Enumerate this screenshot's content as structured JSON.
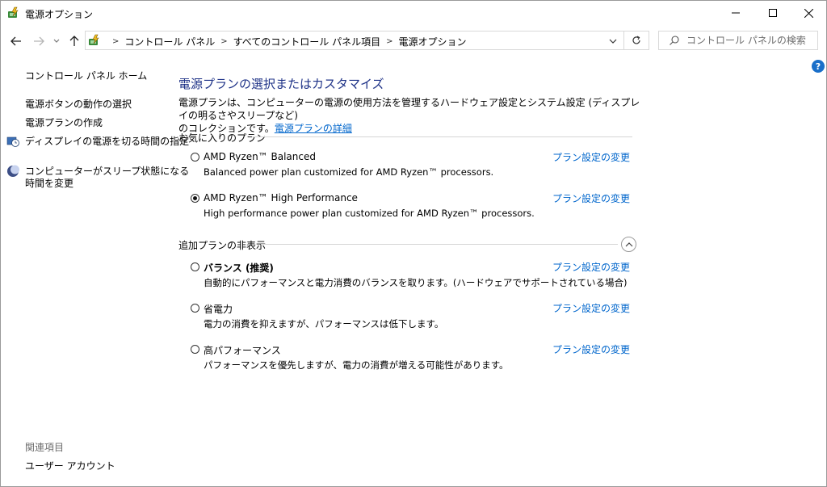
{
  "window": {
    "title": "電源オプション",
    "controls": {
      "minimize": "—",
      "maximize": "☐",
      "close": "✕"
    }
  },
  "address_bar": {
    "breadcrumbs": [
      "コントロール パネル",
      "すべてのコントロール パネル項目",
      "電源オプション"
    ]
  },
  "search": {
    "placeholder": "コントロール パネルの検索"
  },
  "sidebar": {
    "home": "コントロール パネル ホーム",
    "items": [
      "電源ボタンの動作の選択",
      "電源プランの作成",
      "ディスプレイの電源を切る時間の指定",
      "コンピューターがスリープ状態になる",
      "時間を変更"
    ],
    "related_header": "関連項目",
    "related_items": [
      "ユーザー アカウント"
    ]
  },
  "main": {
    "heading": "電源プランの選択またはカスタマイズ",
    "description_line1": "電源プランは、コンピューターの電源の使用方法を管理するハードウェア設定とシステム設定 (ディスプレイの明るさやスリープなど)",
    "description_line2": "のコレクションです。",
    "description_link": "電源プランの詳細",
    "favorites_header": "お気に入りのプラン",
    "hidden_header": "追加プランの非表示",
    "change_link": "プラン設定の変更",
    "favorite_plans": [
      {
        "name": "AMD Ryzen™ Balanced",
        "desc": "Balanced power plan customized for AMD Ryzen™ processors.",
        "selected": false
      },
      {
        "name": "AMD Ryzen™ High Performance",
        "desc": "High performance power plan customized for AMD Ryzen™ processors.",
        "selected": true
      }
    ],
    "additional_plans": [
      {
        "name": "バランス (推奨)",
        "desc": "自動的にパフォーマンスと電力消費のバランスを取ります。(ハードウェアでサポートされている場合)",
        "selected": false
      },
      {
        "name": "省電力",
        "desc": "電力の消費を抑えますが、パフォーマンスは低下します。",
        "selected": false
      },
      {
        "name": "高パフォーマンス",
        "desc": "パフォーマンスを優先しますが、電力の消費が増える可能性があります。",
        "selected": false
      }
    ]
  },
  "colors": {
    "link": "#0066cc",
    "heading": "#1e3287"
  }
}
